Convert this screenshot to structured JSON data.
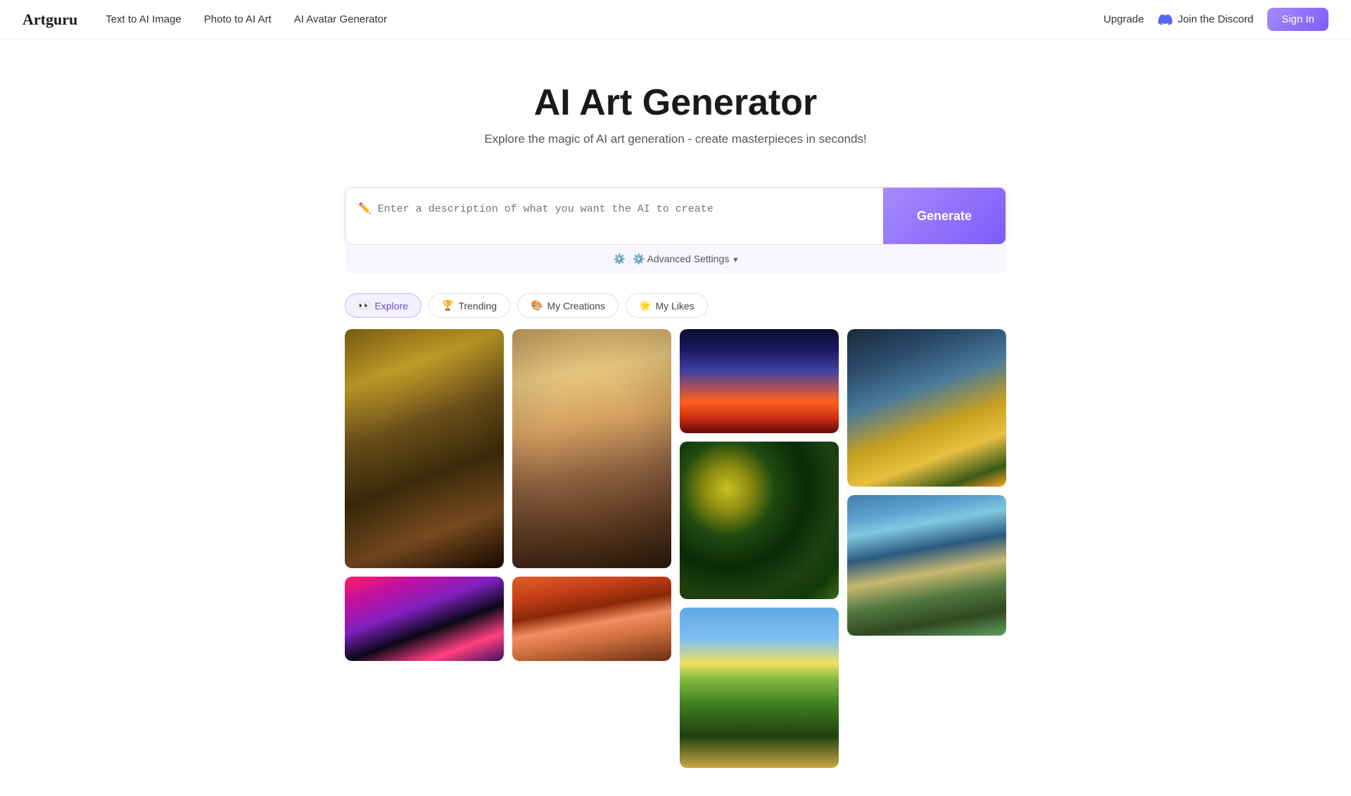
{
  "brand": {
    "logo": "Artguru"
  },
  "nav": {
    "links": [
      {
        "id": "text-to-image",
        "label": "Text to AI Image"
      },
      {
        "id": "photo-to-art",
        "label": "Photo to AI Art"
      },
      {
        "id": "ai-avatar",
        "label": "AI Avatar Generator"
      }
    ],
    "right": {
      "upgrade": "Upgrade",
      "discord": "Join the Discord",
      "signin": "Sign In"
    }
  },
  "hero": {
    "title": "AI Art Generator",
    "subtitle": "Explore the magic of AI art generation - create masterpieces in seconds!"
  },
  "generator": {
    "placeholder": "✏️ Enter a description of what you want the AI to create",
    "generate_btn": "Generate",
    "advanced_label": "⚙️ Advanced Settings"
  },
  "tabs": [
    {
      "id": "explore",
      "emoji": "👀",
      "label": "Explore",
      "active": true
    },
    {
      "id": "trending",
      "emoji": "🏆",
      "label": "Trending",
      "active": false
    },
    {
      "id": "my-creations",
      "emoji": "🎨",
      "label": "My Creations",
      "active": false
    },
    {
      "id": "my-likes",
      "emoji": "🌟",
      "label": "My Likes",
      "active": false
    }
  ],
  "gallery": {
    "images": [
      {
        "id": "img-1",
        "style": "ornate-warrior",
        "col": 1
      },
      {
        "id": "img-2",
        "style": "blonde-girl",
        "col": 2
      },
      {
        "id": "img-3",
        "style": "planet-sunset",
        "col": 3
      },
      {
        "id": "img-4",
        "style": "sci-fi-machine",
        "col": 4
      },
      {
        "id": "img-5",
        "style": "van-gogh-landscape",
        "col": 3
      },
      {
        "id": "img-6",
        "style": "countryside",
        "col": 3
      },
      {
        "id": "img-7",
        "style": "mountain-lake",
        "col": 4
      },
      {
        "id": "img-8",
        "style": "cyberpunk",
        "col": 1
      },
      {
        "id": "img-9",
        "style": "red-hair",
        "col": 2
      }
    ]
  }
}
